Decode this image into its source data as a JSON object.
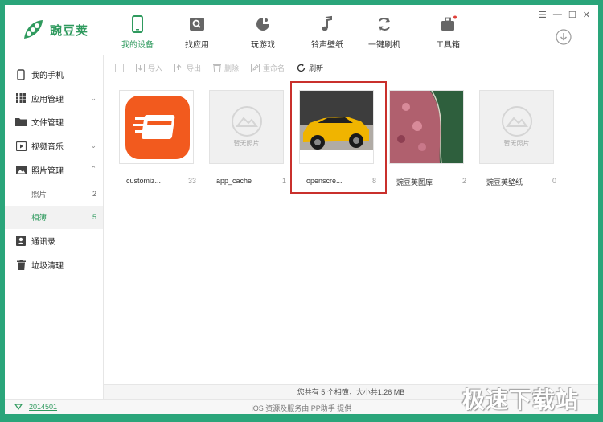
{
  "app": {
    "name": "豌豆荚"
  },
  "nav": [
    {
      "label": "我的设备",
      "icon": "phone-icon",
      "active": true
    },
    {
      "label": "找应用",
      "icon": "app-search-icon"
    },
    {
      "label": "玩游戏",
      "icon": "game-icon"
    },
    {
      "label": "铃声壁纸",
      "icon": "music-note-icon"
    },
    {
      "label": "一键刷机",
      "icon": "refresh-icon"
    },
    {
      "label": "工具箱",
      "icon": "toolbox-icon"
    }
  ],
  "sidebar": {
    "items": [
      {
        "label": "我的手机",
        "icon": "phone-icon"
      },
      {
        "label": "应用管理",
        "icon": "grid-icon",
        "expandable": true
      },
      {
        "label": "文件管理",
        "icon": "folder-icon"
      },
      {
        "label": "视频音乐",
        "icon": "video-icon",
        "expandable": true
      },
      {
        "label": "照片管理",
        "icon": "photo-icon",
        "expanded": true
      },
      {
        "label": "通讯录",
        "icon": "contacts-icon"
      },
      {
        "label": "垃圾清理",
        "icon": "trash-icon"
      }
    ],
    "photo_sub": [
      {
        "label": "照片",
        "count": "2"
      },
      {
        "label": "相簿",
        "count": "5",
        "active": true
      }
    ]
  },
  "toolbar": {
    "import_label": "导入",
    "export_label": "导出",
    "delete_label": "删除",
    "rename_label": "重命名",
    "refresh_label": "刷新"
  },
  "albums": [
    {
      "name": "customiz...",
      "count": "33"
    },
    {
      "name": "app_cache",
      "count": "1",
      "placeholder": "暂无照片"
    },
    {
      "name": "openscre...",
      "count": "8"
    },
    {
      "name": "豌豆荚图库",
      "count": "2"
    },
    {
      "name": "豌豆荚壁纸",
      "count": "0",
      "placeholder": "暂无照片"
    }
  ],
  "status": "您共有 5 个相簿，大小共1.26 MB",
  "footer": {
    "version": "2014501",
    "credit": "iOS 资源及服务由 PP助手 提供"
  },
  "watermark": "极速下载站",
  "colors": {
    "accent": "#2f9a5e",
    "frame": "#2aa57a",
    "highlight": "#c9302c"
  }
}
